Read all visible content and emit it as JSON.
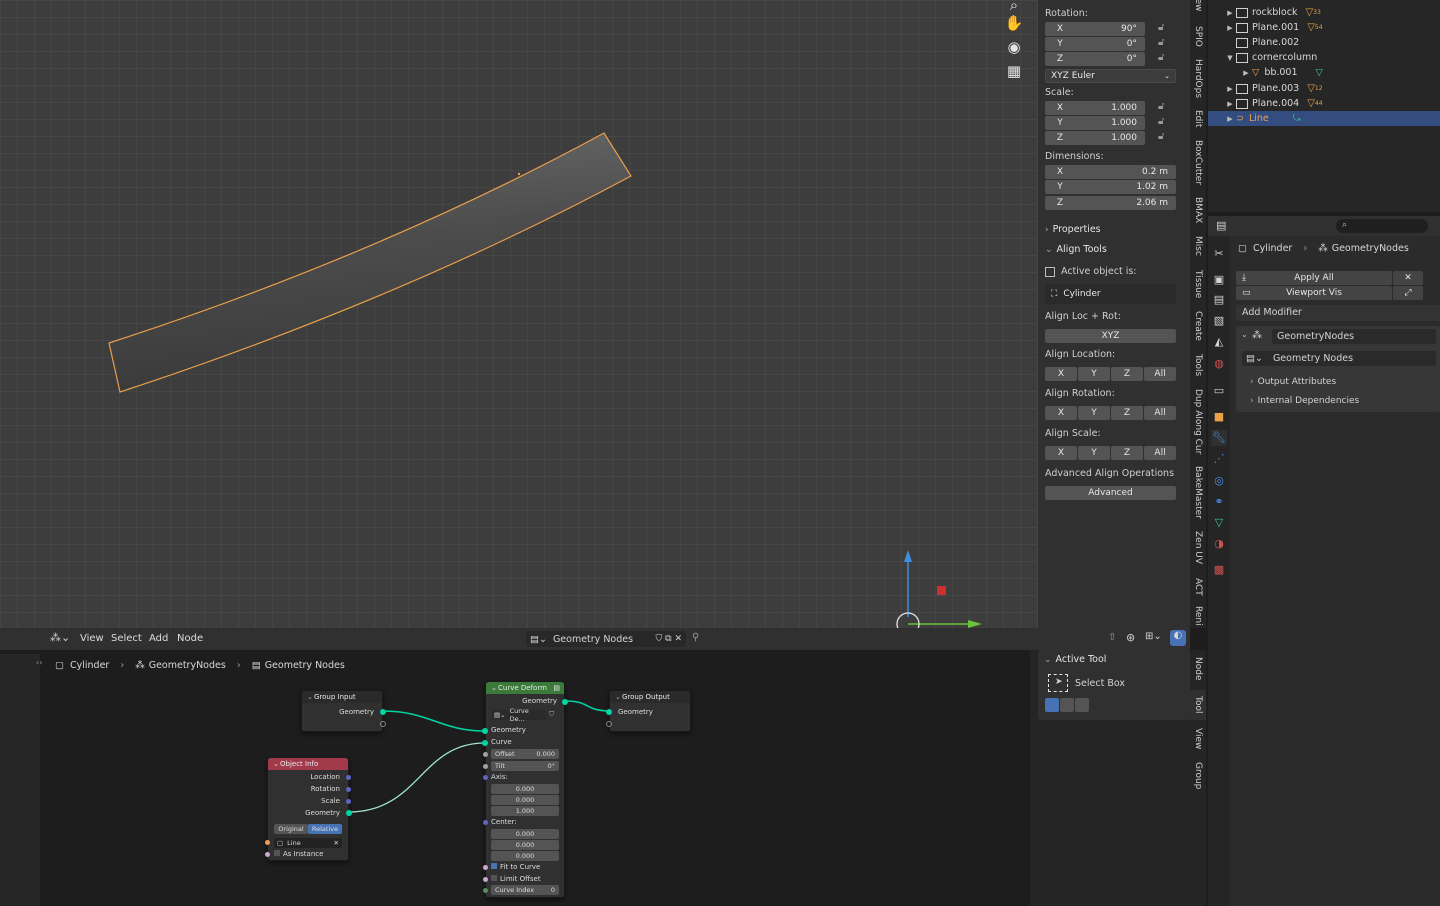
{
  "colors": {
    "accent": "#4772b3",
    "selection_orange": "#e8a049",
    "geometry_socket": "#00d6a3",
    "object_info_header": "#a33a4c",
    "node_header": "#3a7a3a"
  },
  "viewport": {
    "tools": [
      "zoom-icon",
      "hand-icon",
      "camera-icon",
      "grid-icon"
    ]
  },
  "npanel": {
    "rotation_label": "Rotation:",
    "rotation": [
      {
        "axis": "X",
        "value": "90°"
      },
      {
        "axis": "Y",
        "value": "0°"
      },
      {
        "axis": "Z",
        "value": "0°"
      }
    ],
    "rotation_mode": "XYZ Euler",
    "scale_label": "Scale:",
    "scale": [
      {
        "axis": "X",
        "value": "1.000"
      },
      {
        "axis": "Y",
        "value": "1.000"
      },
      {
        "axis": "Z",
        "value": "1.000"
      }
    ],
    "dimensions_label": "Dimensions:",
    "dimensions": [
      {
        "axis": "X",
        "value": "0.2 m"
      },
      {
        "axis": "Y",
        "value": "1.02 m"
      },
      {
        "axis": "Z",
        "value": "2.06 m"
      }
    ],
    "properties_label": "Properties",
    "align_tools_label": "Align Tools",
    "active_object_label": "Active object is:",
    "active_object": "Cylinder",
    "align_loc_rot_label": "Align Loc + Rot:",
    "align_loc_rot_btn": "XYZ",
    "align_location_label": "Align Location:",
    "align_rotation_label": "Align Rotation:",
    "align_scale_label": "Align Scale:",
    "axis_buttons": [
      "X",
      "Y",
      "Z",
      "All"
    ],
    "advanced_label": "Advanced Align Operations",
    "advanced_btn": "Advanced"
  },
  "side_tabs_top": [
    "iew",
    "SPIO",
    "HardOps",
    "Edit",
    "BoxCutter",
    "BMAX",
    "Misc",
    "Tissue",
    "Create",
    "Tools",
    "Dup Along Cur",
    "BakeMaster",
    "Zen UV",
    "ACT",
    "Reni"
  ],
  "side_tabs_bottom": [
    "Node",
    "Tool",
    "View",
    "Group"
  ],
  "outliner": {
    "rows": [
      {
        "name": "rockblock",
        "count": "33"
      },
      {
        "name": "Plane.001",
        "count": "54"
      },
      {
        "name": "Plane.002",
        "count": ""
      },
      {
        "name": "cornercolumn",
        "count": ""
      },
      {
        "name": "bb.001",
        "count": ""
      },
      {
        "name": "Plane.003",
        "count": "12"
      },
      {
        "name": "Plane.004",
        "count": "44"
      },
      {
        "name": "Line",
        "count": ""
      }
    ]
  },
  "properties": {
    "breadcrumb_object": "Cylinder",
    "breadcrumb_modifier": "GeometryNodes",
    "apply_all": "Apply All",
    "viewport_vis": "Viewport Vis",
    "add_modifier": "Add Modifier",
    "modifier_name": "GeometryNodes",
    "node_group": "Geometry Nodes",
    "output_attributes": "Output Attributes",
    "internal_dependencies": "Internal Dependencies"
  },
  "node_editor": {
    "menu": [
      "View",
      "Select",
      "Add",
      "Node"
    ],
    "node_tree": "Geometry Nodes",
    "breadcrumb": [
      "Cylinder",
      "GeometryNodes",
      "Geometry Nodes"
    ],
    "group_input": {
      "title": "Group Input",
      "output": "Geometry"
    },
    "group_output": {
      "title": "Group Output",
      "input": "Geometry"
    },
    "object_info": {
      "title": "Object Info",
      "outputs": [
        "Location",
        "Rotation",
        "Scale",
        "Geometry"
      ],
      "mode_original": "Original",
      "mode_relative": "Relative",
      "object": "Line",
      "as_instance": "As Instance"
    },
    "curve_deform": {
      "title": "Curve Deform",
      "output": "Geometry",
      "dropdown": "Curve De...",
      "geometry": "Geometry",
      "curve": "Curve",
      "offset_label": "Offset",
      "offset": "0.000",
      "tilt_label": "Tilt",
      "tilt": "0°",
      "axis_label": "Axis:",
      "axis": [
        "0.000",
        "0.000",
        "1.000"
      ],
      "center_label": "Center:",
      "center": [
        "0.000",
        "0.000",
        "0.000"
      ],
      "fit_to_curve": "Fit to Curve",
      "limit_offset": "Limit Offset",
      "curve_index_label": "Curve Index",
      "curve_index": "0"
    }
  },
  "active_tool": {
    "title": "Active Tool",
    "tool": "Select Box"
  }
}
